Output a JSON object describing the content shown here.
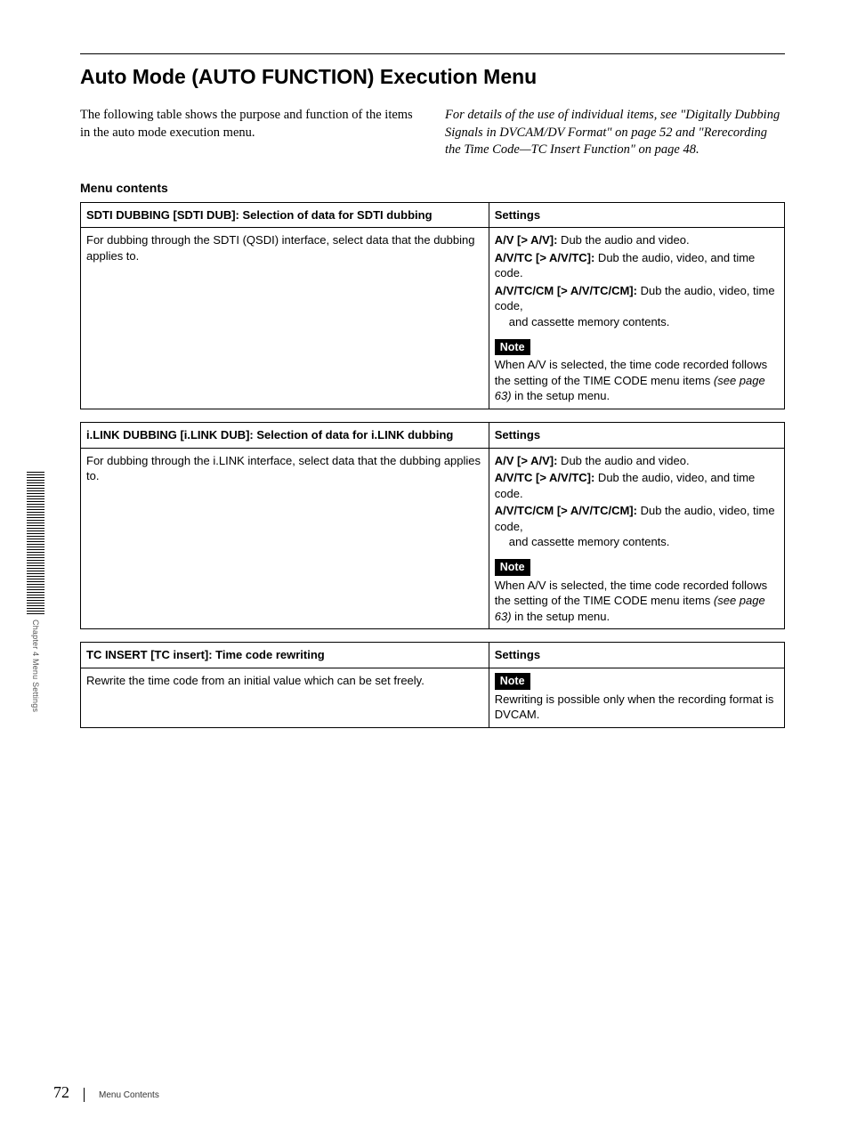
{
  "heading": "Auto Mode (AUTO FUNCTION) Execution Menu",
  "intro_left": "The following table shows the purpose and function of the items in the auto mode execution menu.",
  "intro_right": "For details of the use of individual items, see \"Digitally Dubbing Signals in DVCAM/DV Format\" on page 52 and \"Rerecording the Time Code—TC Insert Function\" on page 48.",
  "menu_contents_heading": "Menu contents",
  "tables": [
    {
      "header_left": "SDTI DUBBING [SDTI DUB]: Selection of data for SDTI dubbing",
      "header_right": "Settings",
      "body_left": "For dubbing through the SDTI (QSDI) interface, select data that the dubbing applies to.",
      "settings": [
        {
          "label": "A/V [> A/V]:",
          "text": " Dub the audio and video."
        },
        {
          "label": "A/V/TC [> A/V/TC]:",
          "text": " Dub the audio, video, and time code."
        },
        {
          "label": "A/V/TC/CM [> A/V/TC/CM]:",
          "text": " Dub the audio, video, time code,",
          "indent": "and cassette memory contents."
        }
      ],
      "note_label": "Note",
      "note_pre": "When A/V is selected, the time code recorded follows the setting of the TIME CODE menu items ",
      "note_italic": "(see page 63)",
      "note_post": " in the setup menu."
    },
    {
      "header_left": "i.LINK DUBBING [i.LINK DUB]: Selection of data for i.LINK dubbing",
      "header_right": "Settings",
      "body_left": "For dubbing through the i.LINK interface, select data that the dubbing applies to.",
      "settings": [
        {
          "label": "A/V [> A/V]:",
          "text": " Dub the audio and video."
        },
        {
          "label": "A/V/TC [> A/V/TC]:",
          "text": " Dub the audio, video, and time code."
        },
        {
          "label": "A/V/TC/CM [> A/V/TC/CM]:",
          "text": " Dub the audio, video, time code,",
          "indent": "and cassette memory contents."
        }
      ],
      "note_label": "Note",
      "note_pre": "When A/V is selected, the time code recorded follows the setting of the TIME CODE menu items ",
      "note_italic": "(see page 63)",
      "note_post": " in the setup menu."
    },
    {
      "header_left": "TC INSERT [TC insert]: Time code rewriting",
      "header_right": "Settings",
      "body_left": "Rewrite the time code from an initial value which can be set freely.",
      "settings": [],
      "note_label": "Note",
      "note_pre": "Rewriting is possible only when the recording format is DVCAM.",
      "note_italic": "",
      "note_post": ""
    }
  ],
  "side_label": "Chapter 4   Menu Settings",
  "footer": {
    "page": "72",
    "label": "Menu Contents"
  }
}
